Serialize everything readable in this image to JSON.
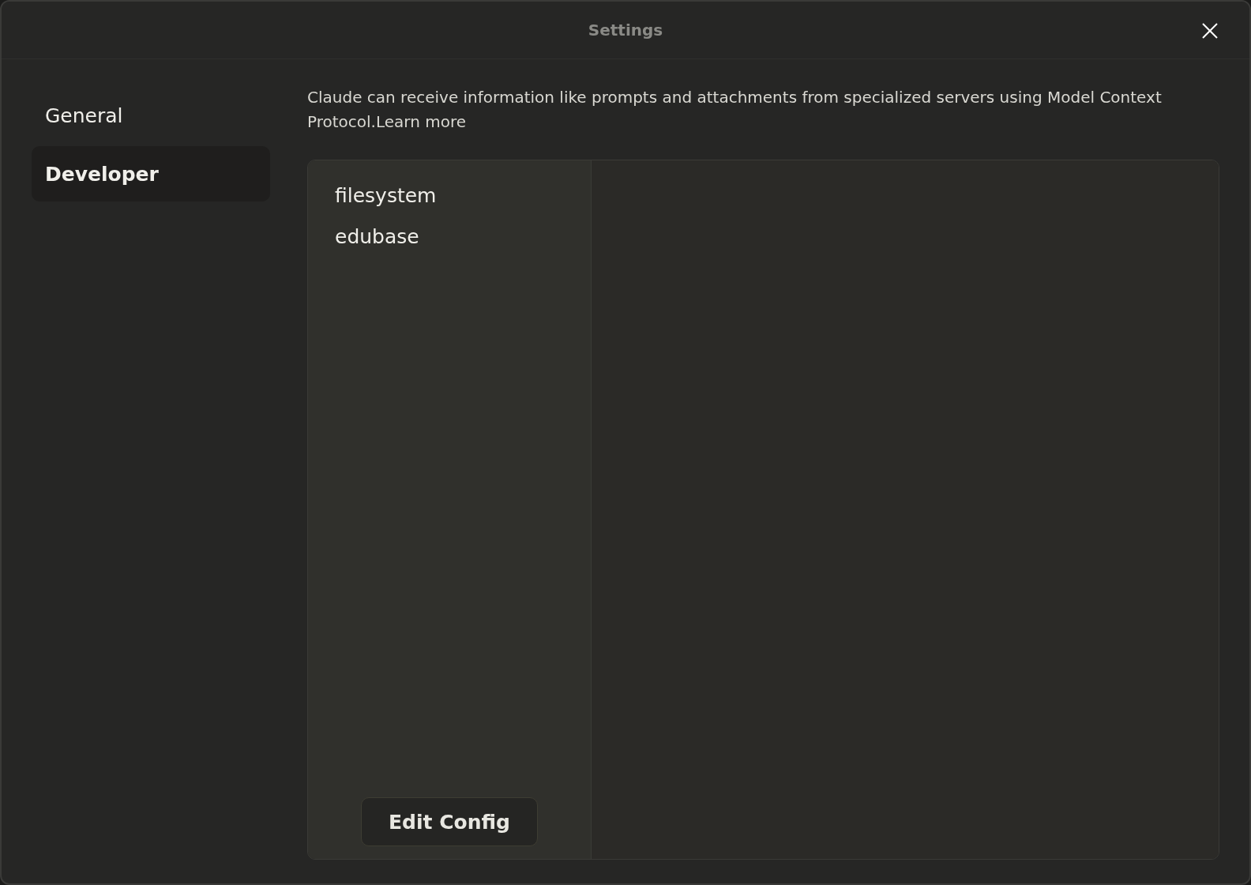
{
  "window": {
    "title": "Settings"
  },
  "sidebar": {
    "items": [
      {
        "label": "General",
        "selected": false
      },
      {
        "label": "Developer",
        "selected": true
      }
    ]
  },
  "description": {
    "text": "Claude can receive information like prompts and attachments from specialized servers using Model Context Protocol.",
    "link": "Learn more"
  },
  "servers": [
    "filesystem",
    "edubase"
  ],
  "buttons": [
    "Edit Config"
  ]
}
